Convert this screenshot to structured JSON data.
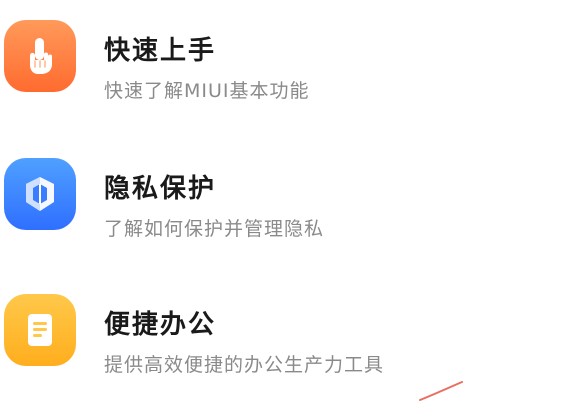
{
  "items": [
    {
      "title": "快速上手",
      "subtitle": "快速了解MIUI基本功能",
      "icon": "hand-pointer-icon",
      "color": "#ff7a3c"
    },
    {
      "title": "隐私保护",
      "subtitle": "了解如何保护并管理隐私",
      "icon": "privacy-shield-icon",
      "color": "#3a7dff"
    },
    {
      "title": "便捷办公",
      "subtitle": "提供高效便捷的办公生产力工具",
      "icon": "document-icon",
      "color": "#ffb524"
    }
  ]
}
